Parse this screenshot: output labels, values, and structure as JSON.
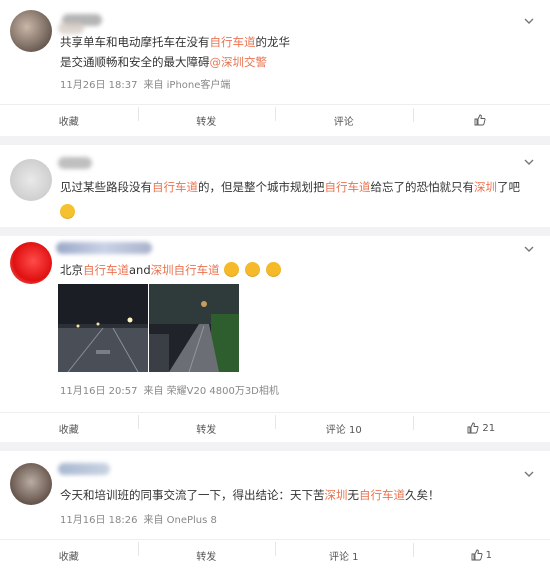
{
  "posts": [
    {
      "content_parts": [
        {
          "text": "共享单车和电动摩托车在没有",
          "hl": false
        },
        {
          "text": "自行车道",
          "hl": true
        },
        {
          "text": "的龙华",
          "hl": false
        }
      ],
      "line2_parts": [
        {
          "text": "是交通顺畅和安全的最大障碍",
          "hl": false
        },
        {
          "text": "@深圳交警",
          "hl": true
        }
      ],
      "time": "11月26日 18:37",
      "source": "来自 iPhone客户端",
      "actions": {
        "fav": "收藏",
        "repost": "转发",
        "comment": "评论",
        "like": ""
      }
    },
    {
      "content_parts": [
        {
          "text": "见过某些路段没有",
          "hl": false
        },
        {
          "text": "自行车道",
          "hl": true
        },
        {
          "text": "的，但是整个城市规划把",
          "hl": false
        },
        {
          "text": "自行车道",
          "hl": true
        },
        {
          "text": "给忘了的恐怕就只有",
          "hl": false
        },
        {
          "text": "深圳",
          "hl": true
        },
        {
          "text": "了吧",
          "hl": false
        }
      ],
      "emoji": "smile-emoji"
    },
    {
      "content_parts": [
        {
          "text": "北京",
          "hl": false
        },
        {
          "text": "自行车道",
          "hl": true
        },
        {
          "text": "and",
          "hl": false
        },
        {
          "text": "深圳自行车道",
          "hl": true
        }
      ],
      "time": "11月16日 20:57",
      "source": "来自 荣耀V20 4800万3D相机",
      "actions": {
        "fav": "收藏",
        "repost": "转发",
        "comment": "评论 10",
        "like": "21"
      }
    },
    {
      "content_parts": [
        {
          "text": "今天和培训班的同事交流了一下，得出结论：天下苦",
          "hl": false
        },
        {
          "text": "深圳",
          "hl": true
        },
        {
          "text": "无",
          "hl": false
        },
        {
          "text": "自行车道",
          "hl": true
        },
        {
          "text": "久矣！",
          "hl": false
        }
      ],
      "time": "11月16日 18:26",
      "source": "来自 OnePlus 8",
      "actions": {
        "fav": "收藏",
        "repost": "转发",
        "comment": "评论 1",
        "like": "1"
      }
    }
  ],
  "colors": {
    "highlight": "#eb7350",
    "meta": "#888888",
    "bg": "#f2f2f5"
  }
}
